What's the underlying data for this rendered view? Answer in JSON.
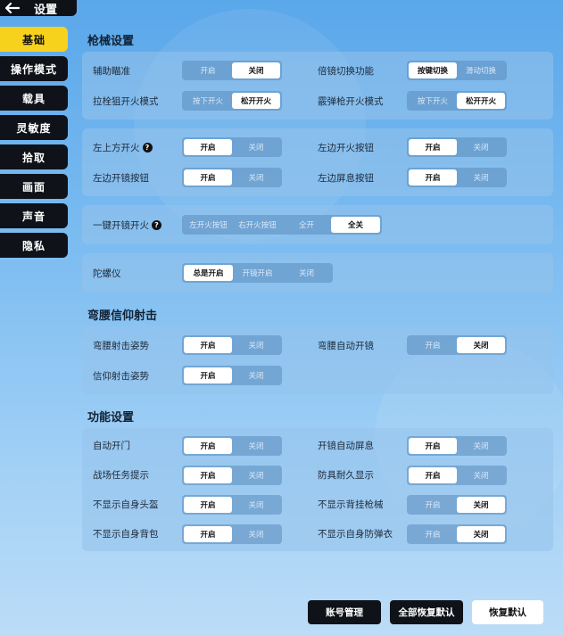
{
  "header": {
    "title": "设置"
  },
  "sidebar": {
    "items": [
      {
        "label": "基础",
        "active": true
      },
      {
        "label": "操作模式",
        "active": false
      },
      {
        "label": "载具",
        "active": false
      },
      {
        "label": "灵敏度",
        "active": false
      },
      {
        "label": "拾取",
        "active": false
      },
      {
        "label": "画面",
        "active": false
      },
      {
        "label": "声音",
        "active": false
      },
      {
        "label": "隐私",
        "active": false
      }
    ]
  },
  "sections": {
    "gun": {
      "title": "枪械设置",
      "aim_assist": {
        "label": "辅助瞄准",
        "on": "开启",
        "off": "关闭",
        "selected": "off"
      },
      "scope_switch": {
        "label": "倍镜切换功能",
        "opt1": "按键切换",
        "opt2": "滑动切换",
        "selected": "opt1"
      },
      "bolt_fire": {
        "label": "拉栓狙开火模式",
        "opt1": "按下开火",
        "opt2": "松开开火",
        "selected": "opt2"
      },
      "shotgun_fire": {
        "label": "霰弹枪开火模式",
        "opt1": "按下开火",
        "opt2": "松开开火",
        "selected": "opt2"
      },
      "top_left_fire": {
        "label": "左上方开火",
        "on": "开启",
        "off": "关闭",
        "selected": "on"
      },
      "left_fire_btn": {
        "label": "左边开火按钮",
        "on": "开启",
        "off": "关闭",
        "selected": "on"
      },
      "left_scope_btn": {
        "label": "左边开镜按钮",
        "on": "开启",
        "off": "关闭",
        "selected": "on"
      },
      "left_breath_btn": {
        "label": "左边屏息按钮",
        "on": "开启",
        "off": "关闭",
        "selected": "on"
      },
      "one_key_scope": {
        "label": "一键开镜开火",
        "opt1": "左开火按钮",
        "opt2": "右开火按钮",
        "opt3": "全开",
        "opt4": "全关",
        "selected": "opt4"
      },
      "gyro": {
        "label": "陀螺仪",
        "opt1": "总是开启",
        "opt2": "开镜开启",
        "opt3": "关闭",
        "selected": "opt1"
      }
    },
    "hip": {
      "title": "弯腰信仰射击",
      "hip_pose": {
        "label": "弯腰射击姿势",
        "on": "开启",
        "off": "关闭",
        "selected": "on"
      },
      "hip_auto_scope": {
        "label": "弯腰自动开镜",
        "on": "开启",
        "off": "关闭",
        "selected": "off"
      },
      "faith_pose": {
        "label": "信仰射击姿势",
        "on": "开启",
        "off": "关闭",
        "selected": "on"
      }
    },
    "func": {
      "title": "功能设置",
      "auto_door": {
        "label": "自动开门",
        "on": "开启",
        "off": "关闭",
        "selected": "on"
      },
      "scope_breath": {
        "label": "开镜自动屏息",
        "on": "开启",
        "off": "关闭",
        "selected": "on"
      },
      "mission_tip": {
        "label": "战场任务提示",
        "on": "开启",
        "off": "关闭",
        "selected": "on"
      },
      "armor_durability": {
        "label": "防具耐久显示",
        "on": "开启",
        "off": "关闭",
        "selected": "on"
      },
      "hide_helmet": {
        "label": "不显示自身头盔",
        "on": "开启",
        "off": "关闭",
        "selected": "on"
      },
      "hide_back_gun": {
        "label": "不显示背挂枪械",
        "on": "开启",
        "off": "关闭",
        "selected": "off"
      },
      "hide_backpack": {
        "label": "不显示自身背包",
        "on": "开启",
        "off": "关闭",
        "selected": "on"
      },
      "hide_vest": {
        "label": "不显示自身防弹衣",
        "on": "开启",
        "off": "关闭",
        "selected": "off"
      }
    }
  },
  "footer": {
    "account": "账号管理",
    "reset_all": "全部恢复默认",
    "reset": "恢复默认"
  }
}
